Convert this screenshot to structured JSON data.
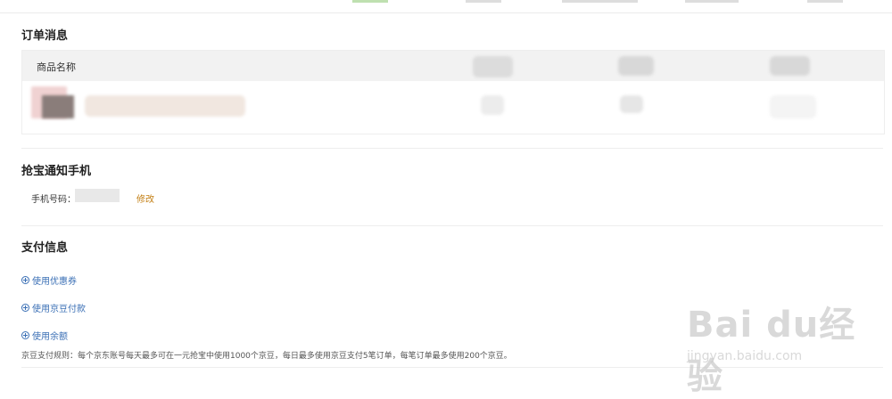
{
  "order": {
    "title": "订单消息",
    "column_product_name": "商品名称"
  },
  "notify": {
    "title": "抢宝通知手机",
    "phone_label": "手机号码：",
    "modify_label": "修改"
  },
  "payment": {
    "title": "支付信息",
    "options": [
      {
        "label": "使用优惠券"
      },
      {
        "label": "使用京豆付款"
      },
      {
        "label": "使用余额"
      }
    ],
    "rule_text": "京豆支付规则：每个京东账号每天最多可在一元抢宝中使用1000个京豆，每日最多使用京豆支付5笔订单，每笔订单最多使用200个京豆。"
  },
  "watermark": {
    "logo": "Bai du经验",
    "url": "jingyan.baidu.com"
  },
  "colors": {
    "link_blue": "#3a6fb5",
    "modify_orange": "#c37f14",
    "header_gray": "#f2f2f2"
  }
}
